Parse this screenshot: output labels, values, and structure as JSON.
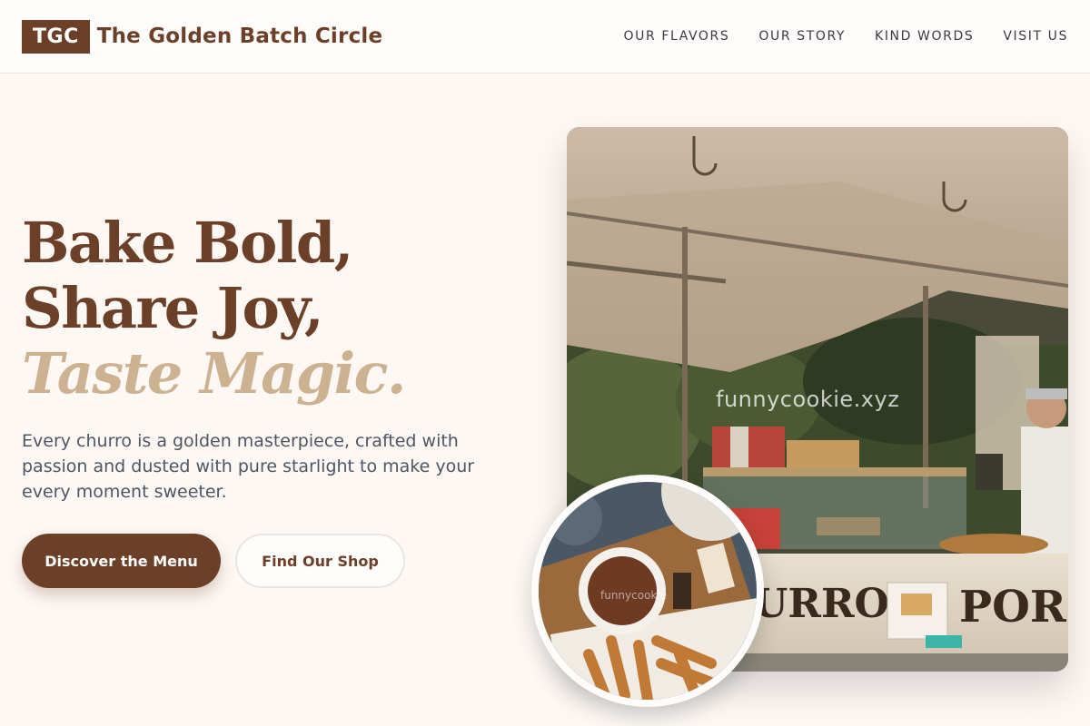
{
  "header": {
    "logo": "TGC",
    "brand_name": "The Golden Batch Circle",
    "nav": [
      "OUR FLAVORS",
      "OUR STORY",
      "KIND WORDS",
      "VISIT US"
    ]
  },
  "hero": {
    "line1": "Bake Bold,",
    "line2": "Share Joy,",
    "line3": "Taste Magic.",
    "subtitle": "Every churro is a golden masterpiece, crafted with passion and dusted with pure starlight to make your every moment sweeter.",
    "primary_button": "Discover the Menu",
    "secondary_button": "Find Our Shop"
  },
  "images": {
    "stall_sign_1": "URROS",
    "stall_sign_2": "POR",
    "watermark": "funnycookie.xyz",
    "plate_watermark": "funnycookie"
  },
  "colors": {
    "brand": "#6b3f28",
    "accent": "#cdb292",
    "background": "#fdf8f4"
  }
}
